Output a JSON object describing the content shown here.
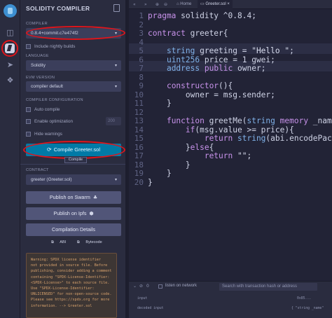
{
  "panel": {
    "title": "SOLIDITY COMPILER",
    "compiler_label": "COMPILER",
    "compiler_value": "0.8.4+commit.c7e474f2",
    "nightly_label": "Include nightly builds",
    "language_label": "LANGUAGE",
    "language_value": "Solidity",
    "evm_label": "EVM VERSION",
    "evm_value": "compiler default",
    "config_label": "COMPILER CONFIGURATION",
    "auto_compile_label": "Auto compile",
    "optimization_label": "Enable optimization",
    "runs_value": "200",
    "hide_warnings_label": "Hide warnings",
    "compile_button": "Compile Greeter.sol",
    "compile_tooltip": "Compile",
    "contract_label": "CONTRACT",
    "contract_value": "greeter (Greeter.sol)",
    "publish_swarm": "Publish on Swarm",
    "publish_ipfs": "Publish on Ipfs",
    "compilation_details": "Compilation Details",
    "abi_link": "ABI",
    "bytecode_link": "Bytecode",
    "warning_text": "Warning: SPDX license identifier\nnot provided in source file. Before\npublishing, consider adding a comment\ncontaining \"SPDX-License-Identifier:\n<SPDX-License>\" to each source file.\nUse \"SPDX-License-Identifier:\nUNLICENSED\" for non-open-source code.\nPlease see https://spdx.org for more\ninformation. --> Greeter.sol"
  },
  "tabs": {
    "home": "Home",
    "file": "Greeter.sol"
  },
  "editor": {
    "lines": [
      {
        "n": "1",
        "text": "pragma solidity ^0.8.4;"
      },
      {
        "n": "2",
        "text": ""
      },
      {
        "n": "3",
        "text": "contract greeter{"
      },
      {
        "n": "4",
        "text": ""
      },
      {
        "n": "5",
        "text": "    string greeting = \"Hello \";"
      },
      {
        "n": "6",
        "text": "    uint256 price = 1 gwei;"
      },
      {
        "n": "7",
        "text": "    address public owner;"
      },
      {
        "n": "8",
        "text": ""
      },
      {
        "n": "9",
        "text": "    constructor(){"
      },
      {
        "n": "10",
        "text": "        owner = msg.sender;"
      },
      {
        "n": "11",
        "text": "    }"
      },
      {
        "n": "12",
        "text": ""
      },
      {
        "n": "13",
        "text": "    function greetMe(string memory _name) pub"
      },
      {
        "n": "14",
        "text": "        if(msg.value >= price){"
      },
      {
        "n": "15",
        "text": "            return string(abi.encodePacked("
      },
      {
        "n": "16",
        "text": "        }else{"
      },
      {
        "n": "17",
        "text": "            return \"\";"
      },
      {
        "n": "18",
        "text": "        }"
      },
      {
        "n": "19",
        "text": "    }"
      },
      {
        "n": "20",
        "text": "}"
      }
    ]
  },
  "terminal": {
    "count": "0",
    "listen_label": "listen on network",
    "search_placeholder": "Search with transaction hash or address",
    "row1_key": "input",
    "row1_val": "0x85...",
    "row2_key": "decoded input",
    "row2_val": "{ \"string _name\""
  },
  "colors": {
    "accent": "#007aa6",
    "annotation": "#e0151b"
  }
}
